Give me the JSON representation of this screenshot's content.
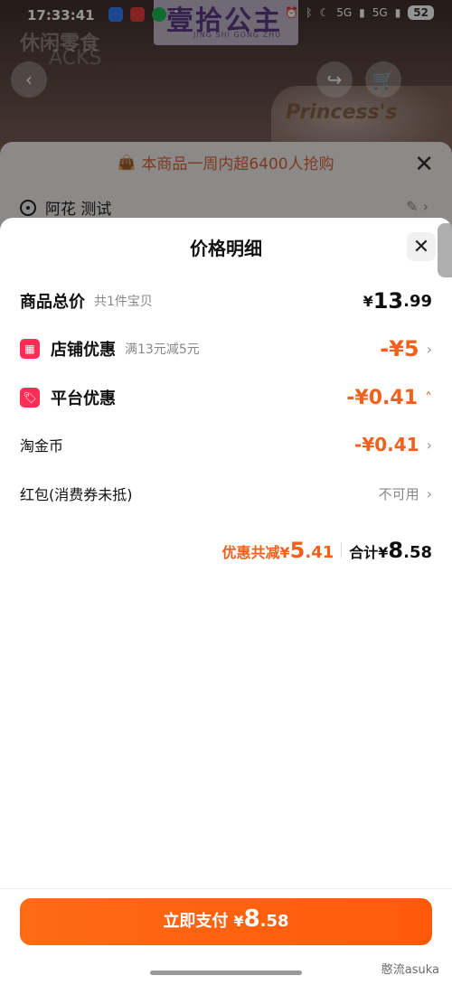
{
  "status_bar": {
    "time": "17:33:41",
    "network_1": "5G",
    "network_2": "5G",
    "battery": "52"
  },
  "hero": {
    "brand": "壹拾公主",
    "brand_sub": "JING SHI GONG ZHU",
    "snack_title": "休闲零食",
    "snack_sub": "ACKS",
    "package_text": "Princess's"
  },
  "sheet1": {
    "promo": "本商品一周内超6400人抢购",
    "address": "阿花 测试"
  },
  "price_detail": {
    "title": "价格明细",
    "total": {
      "label": "商品总价",
      "sub": "共1件宝贝",
      "yen": "¥",
      "int": "13",
      "cents": ".99"
    },
    "shop_discount": {
      "label": "店铺优惠",
      "sub": "满13元减5元",
      "value": "-¥5"
    },
    "platform_discount": {
      "label": "平台优惠",
      "value": "-¥0.41"
    },
    "coins": {
      "label": "淘金币",
      "value": "-¥0.41"
    },
    "red_packet": {
      "label": "红包(消费券未抵)",
      "value": "不可用"
    },
    "summary": {
      "discount_label": "优惠共减",
      "discount_yen": "¥",
      "discount_int": "5",
      "discount_cents": ".41",
      "total_label": "合计",
      "total_yen": "¥",
      "total_int": "8",
      "total_cents": ".58"
    }
  },
  "pay": {
    "label": "立即支付",
    "yen": "¥",
    "int": "8",
    "cents": ".58"
  },
  "watermark": "憨流asuka",
  "colors": {
    "accent": "#f2601a",
    "badge": "#ff2d55"
  }
}
